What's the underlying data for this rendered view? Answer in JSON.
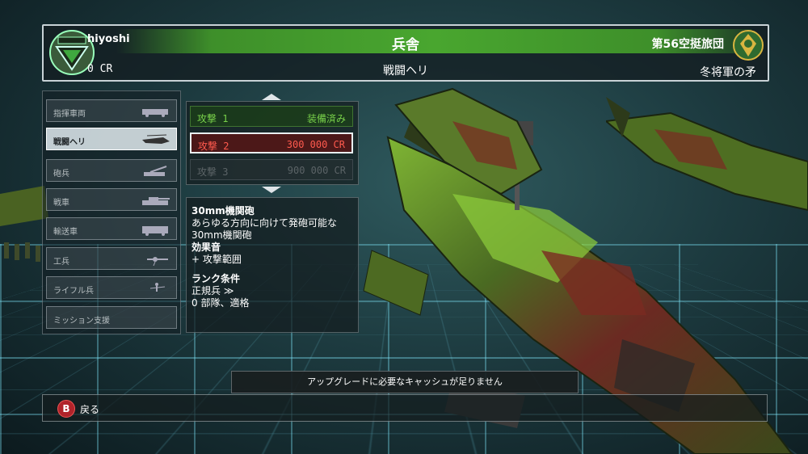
{
  "header": {
    "player_name": "hiyoshi",
    "credits": "0 CR",
    "title": "兵舎",
    "subtitle": "戦闘ヘリ",
    "brigade": "第56空挺旅団",
    "rank_name": "冬将軍の矛"
  },
  "categories": [
    {
      "label": "指揮車両",
      "icon": "command-vehicle-icon",
      "selected": false
    },
    {
      "label": "戦闘ヘリ",
      "icon": "attack-helicopter-icon",
      "selected": true
    },
    {
      "label": "砲兵",
      "icon": "artillery-icon",
      "selected": false
    },
    {
      "label": "戦車",
      "icon": "tank-icon",
      "selected": false
    },
    {
      "label": "輸送車",
      "icon": "transport-icon",
      "selected": false
    },
    {
      "label": "工兵",
      "icon": "engineer-icon",
      "selected": false
    },
    {
      "label": "ライフル兵",
      "icon": "rifleman-icon",
      "selected": false
    },
    {
      "label": "ミッション支援",
      "icon": "",
      "selected": false
    }
  ],
  "upgrades": [
    {
      "name": "攻撃 1",
      "status": "装備済み",
      "state": "equipped"
    },
    {
      "name": "攻撃 2",
      "status": "300 000 CR",
      "state": "selected"
    },
    {
      "name": "攻撃 3",
      "status": "900 000 CR",
      "state": "locked"
    }
  ],
  "description": {
    "weapon_title": "30mm機関砲",
    "weapon_text": "あらゆる方向に向けて発砲可能な30mm機関砲",
    "effect_heading": "効果音",
    "effect_text": "+  攻撃範囲",
    "rank_heading": "ランク条件",
    "rank_required": "正規兵 ≫",
    "rank_units": "0 部隊、適格"
  },
  "message": "アップグレードに必要なキャッシュが足りません",
  "footer": {
    "button": "B",
    "back_label": "戻る"
  },
  "colors": {
    "accent_green": "#49a62f",
    "price_red": "#ff5a4e",
    "equipped_green": "#78d04a"
  }
}
